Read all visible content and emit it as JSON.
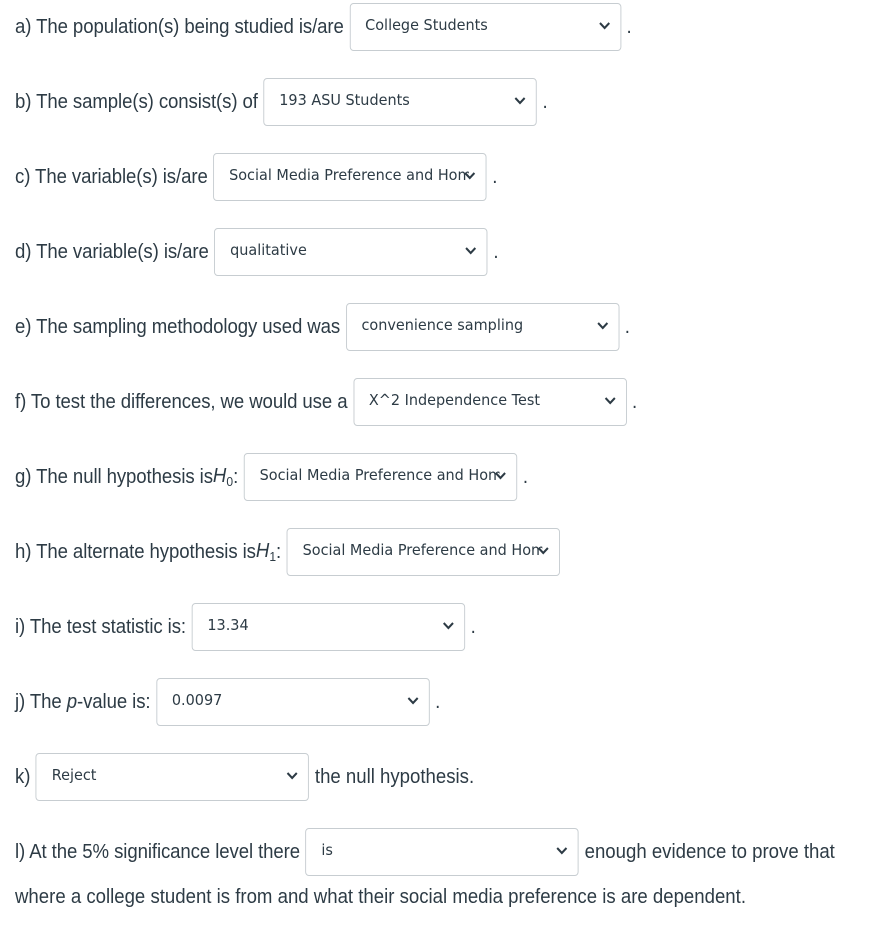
{
  "questions": {
    "a": {
      "label": "a) The population(s) being studied is/are",
      "value": "College Students",
      "suffix": "."
    },
    "b": {
      "label": "b) The sample(s) consist(s) of",
      "value": "193 ASU Students",
      "suffix": "."
    },
    "c": {
      "label": "c) The variable(s) is/are",
      "value": "Social Media Preference and Hometown",
      "suffix": "."
    },
    "d": {
      "label": "d) The variable(s) is/are",
      "value": "qualitative",
      "suffix": "."
    },
    "e": {
      "label": "e) The sampling methodology used was",
      "value": "convenience sampling",
      "suffix": "."
    },
    "f": {
      "label": "f) To test the differences, we would use a",
      "value": "X^2 Independence Test",
      "suffix": "."
    },
    "g": {
      "label": "g) The null hypothesis is ",
      "symbol": "H",
      "subscript": "0",
      "colon": ":",
      "value": "Social Media Preference and Hometown",
      "suffix": "."
    },
    "h": {
      "label": "h) The alternate hypothesis is ",
      "symbol": "H",
      "subscript": "1",
      "colon": ":",
      "value": "Social Media Preference and Hometown",
      "suffix": ""
    },
    "i": {
      "label": "i) The test statistic is:",
      "value": "13.34",
      "suffix": "."
    },
    "j": {
      "label_pre": "j) The ",
      "label_italic": "p",
      "label_post": "-value is:",
      "value": "0.0097",
      "suffix": "."
    },
    "k": {
      "label": "k)",
      "value": "Reject",
      "after": "the null hypothesis."
    },
    "l": {
      "label": "l) At the 5% significance level there",
      "value": "is",
      "after": "enough evidence to prove that",
      "line2": "where a college student is from and what their social media preference is are dependent."
    }
  },
  "icons": {
    "dropdown": "chevron-down-icon"
  }
}
